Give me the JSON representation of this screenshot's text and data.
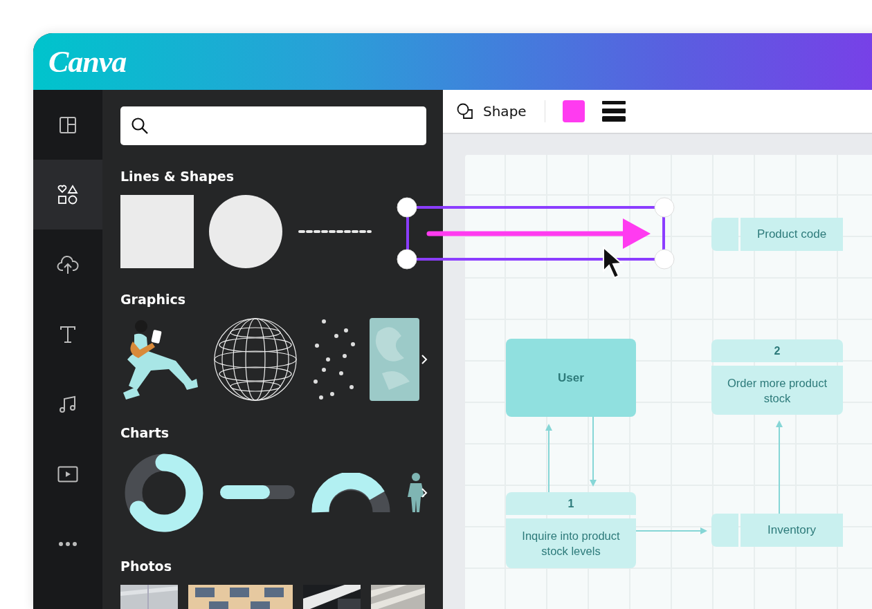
{
  "brand": {
    "logo": "Canva"
  },
  "rail": [
    {
      "kind": "layout",
      "selected": false
    },
    {
      "kind": "elements",
      "selected": true
    },
    {
      "kind": "upload",
      "selected": false
    },
    {
      "kind": "text",
      "selected": false
    },
    {
      "kind": "audio",
      "selected": false
    },
    {
      "kind": "video",
      "selected": false
    },
    {
      "kind": "more",
      "selected": false
    }
  ],
  "panel": {
    "sections": [
      {
        "title": "Lines & Shapes",
        "kind": "shapes",
        "has_next": false
      },
      {
        "title": "Graphics",
        "kind": "graphics",
        "has_next": true
      },
      {
        "title": "Charts",
        "kind": "charts",
        "has_next": true
      },
      {
        "title": "Photos",
        "kind": "photos",
        "has_next": false
      }
    ]
  },
  "toolbar": {
    "label": "Shape"
  },
  "diagram": {
    "nodes": [
      {
        "kind": "store",
        "label": "Product code"
      },
      {
        "kind": "entity",
        "label": "User"
      },
      {
        "kind": "process",
        "number": "2",
        "label": "Order more product stock"
      },
      {
        "kind": "process",
        "number": "1",
        "label": "Inquire into product stock levels"
      },
      {
        "kind": "store",
        "label": "Inventory"
      }
    ]
  }
}
